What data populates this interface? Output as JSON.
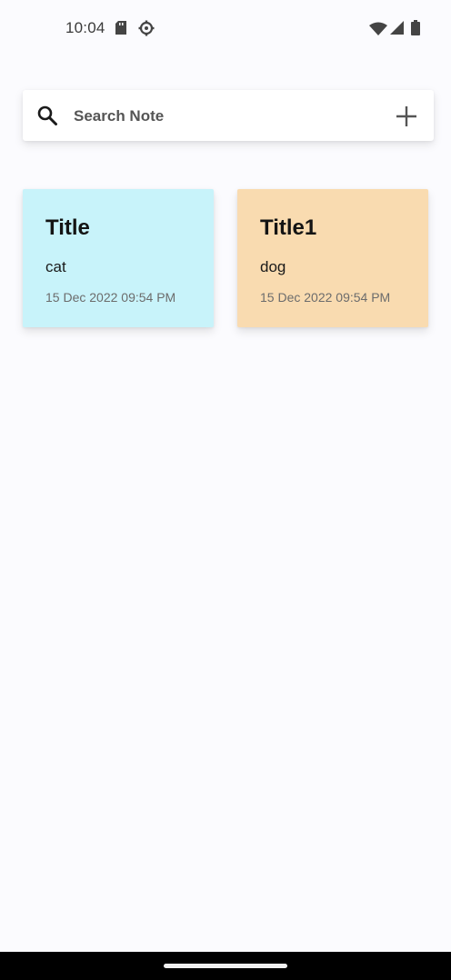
{
  "status_bar": {
    "time": "10:04",
    "icons": [
      "sd-card-icon",
      "settings-gear-icon",
      "wifi-icon",
      "cell-signal-icon",
      "battery-icon"
    ]
  },
  "search": {
    "placeholder": "Search Note",
    "search_icon": "search-icon",
    "add_icon": "plus-icon"
  },
  "notes": [
    {
      "title": "Title",
      "body": "cat",
      "date": "15 Dec 2022 09:54 PM",
      "color": "#c8f3fa"
    },
    {
      "title": "Title1",
      "body": "dog",
      "date": "15 Dec 2022 09:54 PM",
      "color": "#f9dbb0"
    }
  ],
  "nav_bar": {
    "handle": "home-handle"
  }
}
